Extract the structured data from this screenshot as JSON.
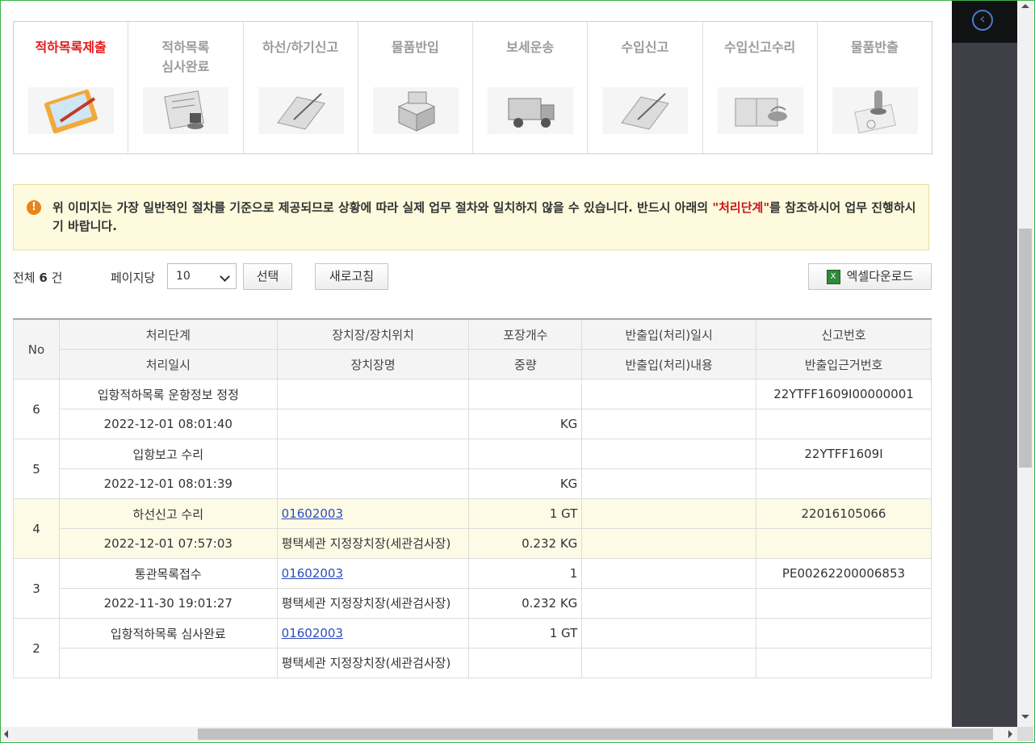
{
  "steps": [
    {
      "label": "적하목록제출",
      "icon": "clipboard-pen-icon",
      "active": true
    },
    {
      "label": "적하목록\n심사완료",
      "icon": "document-stamp-icon",
      "active": false
    },
    {
      "label": "하선/하기신고",
      "icon": "book-pen-icon",
      "active": false
    },
    {
      "label": "물품반입",
      "icon": "boxes-icon",
      "active": false
    },
    {
      "label": "보세운송",
      "icon": "truck-icon",
      "active": false
    },
    {
      "label": "수입신고",
      "icon": "book-pen-icon",
      "active": false
    },
    {
      "label": "수입신고수리",
      "icon": "book-stamp-icon",
      "active": false
    },
    {
      "label": "물품반출",
      "icon": "stamp-icon",
      "active": false
    }
  ],
  "notice": {
    "icon": "warning-icon",
    "before": "위 이미지는 가장 일반적인 절차를 기준으로 제공되므로 상황에 따라 실제 업무 절차와 일치하지 않을 수 있습니다. 반드시 아래의 ",
    "emphasis": "\"처리단계\"",
    "after": "를 참조하시어 업무 진행하시기 바랍니다."
  },
  "toolbar": {
    "total_prefix": "전체",
    "total_count": "6",
    "total_suffix": "건",
    "perpage_label": "페이지당",
    "perpage_value": "10",
    "select_label": "선택",
    "refresh_label": "새로고침",
    "excel_label": "엑셀다운로드"
  },
  "table": {
    "headers": {
      "no": "No",
      "row1": [
        "처리단계",
        "장치장/장치위치",
        "포장개수",
        "반출입(처리)일시",
        "신고번호"
      ],
      "row2": [
        "처리일시",
        "장치장명",
        "중량",
        "반출입(처리)내용",
        "반출입근거번호"
      ]
    },
    "rows": [
      {
        "no": "6",
        "stage": "입항적하목록 운항정보 정정",
        "loc": "",
        "pkg": "",
        "inout_dt": "",
        "declno": "22YTFF1609I00000001",
        "proc_dt": "2022-12-01 08:01:40",
        "loc_name": "",
        "weight": "KG",
        "inout_desc": "",
        "basis_no": "",
        "hl": false
      },
      {
        "no": "5",
        "stage": "입항보고 수리",
        "loc": "",
        "pkg": "",
        "inout_dt": "",
        "declno": "22YTFF1609I",
        "proc_dt": "2022-12-01 08:01:39",
        "loc_name": "",
        "weight": "KG",
        "inout_desc": "",
        "basis_no": "",
        "hl": false
      },
      {
        "no": "4",
        "stage": "하선신고 수리",
        "loc": "01602003",
        "pkg": "1 GT",
        "inout_dt": "",
        "declno": "22016105066",
        "proc_dt": "2022-12-01 07:57:03",
        "loc_name": "평택세관 지정장치장(세관검사장)",
        "weight": "0.232 KG",
        "inout_desc": "",
        "basis_no": "",
        "hl": true
      },
      {
        "no": "3",
        "stage": "통관목록접수",
        "loc": "01602003",
        "pkg": "1",
        "inout_dt": "",
        "declno": "PE00262200006853",
        "proc_dt": "2022-11-30 19:01:27",
        "loc_name": "평택세관 지정장치장(세관검사장)",
        "weight": "0.232 KG",
        "inout_desc": "",
        "basis_no": "",
        "hl": false
      },
      {
        "no": "2",
        "stage": "입항적하목록 심사완료",
        "loc": "01602003",
        "pkg": "1 GT",
        "inout_dt": "",
        "declno": "",
        "proc_dt": "",
        "loc_name": "평택세관 지정장치장(세관검사장)",
        "weight": "",
        "inout_desc": "",
        "basis_no": "",
        "hl": false
      }
    ]
  },
  "colors": {
    "active_step": "#e21a1a",
    "link": "#2e4dbb",
    "notice_bg": "#fdfadd",
    "highlight_row": "#fdfbe6"
  }
}
